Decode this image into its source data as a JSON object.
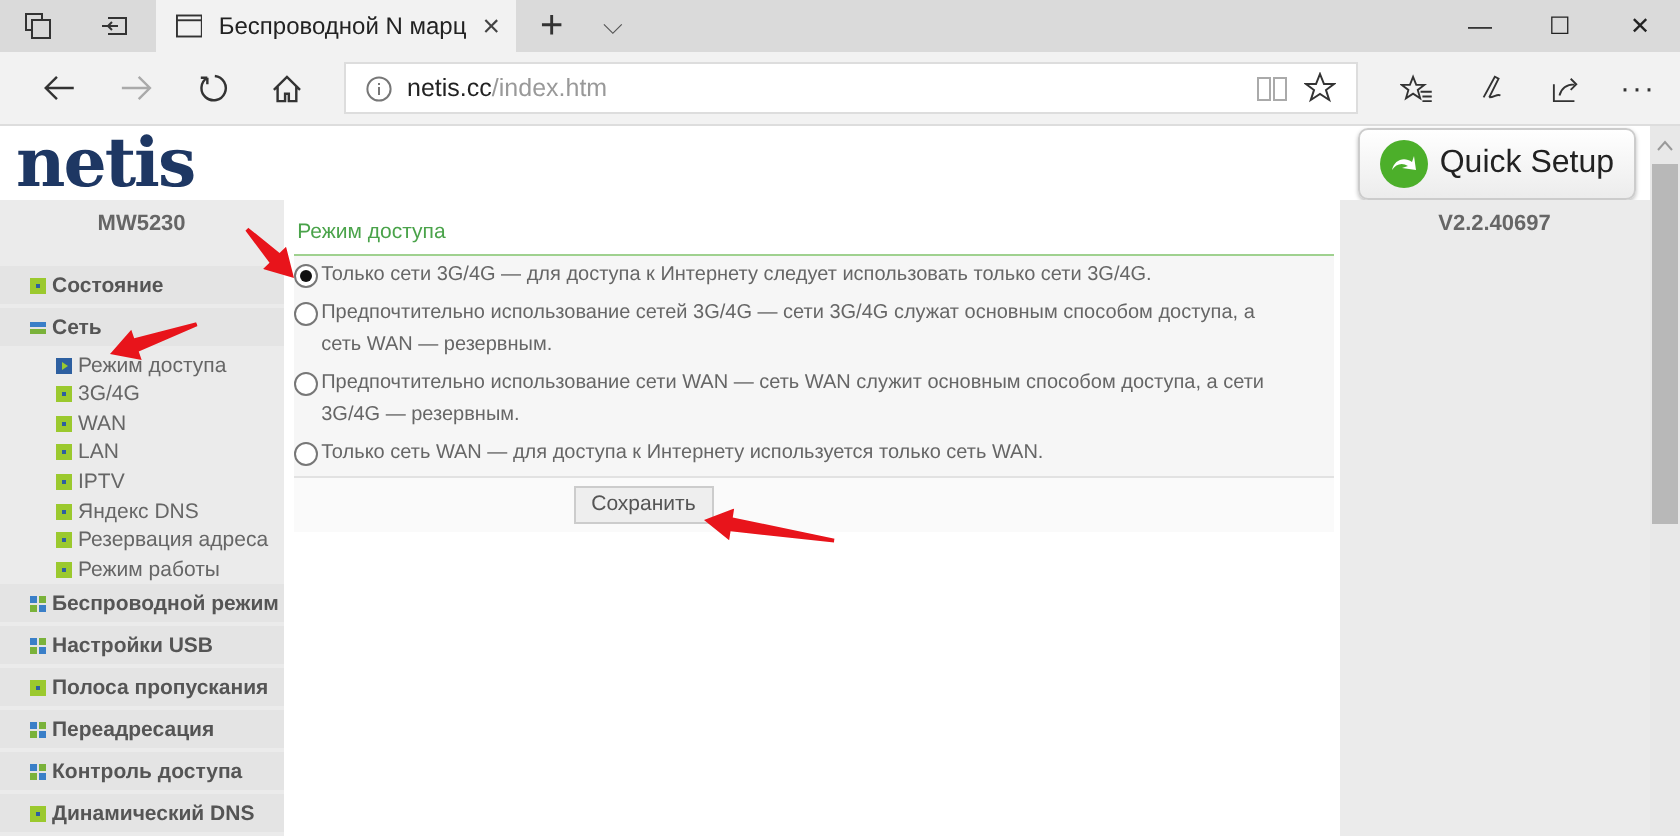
{
  "browser": {
    "tab_title": "Беспроводной N марц",
    "close": "×",
    "new_tab": "+",
    "tab_menu": "⌵",
    "minimize": "—",
    "maximize": "☐",
    "close_window": "✕",
    "address_host": "netis.cc",
    "address_path": "/index.htm",
    "more": "···"
  },
  "header": {
    "logo": "netis",
    "quick_setup": "Quick Setup"
  },
  "model": "MW5230",
  "version": "V2.2.40697",
  "menu": [
    {
      "label": "Состояние",
      "kind": "page"
    },
    {
      "label": "Сеть",
      "kind": "group",
      "expanded": true,
      "children": [
        {
          "label": "Режим доступа",
          "selected": true
        },
        {
          "label": "3G/4G",
          "selected": false
        },
        {
          "label": "WAN",
          "selected": false
        },
        {
          "label": "LAN",
          "selected": false
        },
        {
          "label": "IPTV",
          "selected": false
        },
        {
          "label": "Яндекс DNS",
          "selected": false
        },
        {
          "label": "Резервация адреса",
          "selected": false
        },
        {
          "label": "Режим работы",
          "selected": false
        }
      ]
    },
    {
      "label": "Беспроводной режим",
      "kind": "group",
      "expanded": false
    },
    {
      "label": "Настройки USB",
      "kind": "group",
      "expanded": false
    },
    {
      "label": "Полоса пропускания",
      "kind": "page"
    },
    {
      "label": "Переадресация",
      "kind": "group",
      "expanded": false
    },
    {
      "label": "Контроль доступа",
      "kind": "group",
      "expanded": false
    },
    {
      "label": "Динамический DNS",
      "kind": "page"
    }
  ],
  "panel": {
    "title": "Режим доступа",
    "options": [
      {
        "label": "Только сети 3G/4G — для доступа к Интернету следует использовать только сети 3G/4G.",
        "selected": true
      },
      {
        "label": "Предпочтительно использование сетей 3G/4G — сети 3G/4G служат основным способом доступа, а сеть WAN — резервным.",
        "selected": false
      },
      {
        "label": "Предпочтительно использование сети WAN — сеть WAN служит основным способом доступа, а сети 3G/4G — резервным.",
        "selected": false
      },
      {
        "label": "Только сеть WAN — для доступа к Интернету используется только сеть WAN.",
        "selected": false
      }
    ],
    "save": "Сохранить"
  }
}
